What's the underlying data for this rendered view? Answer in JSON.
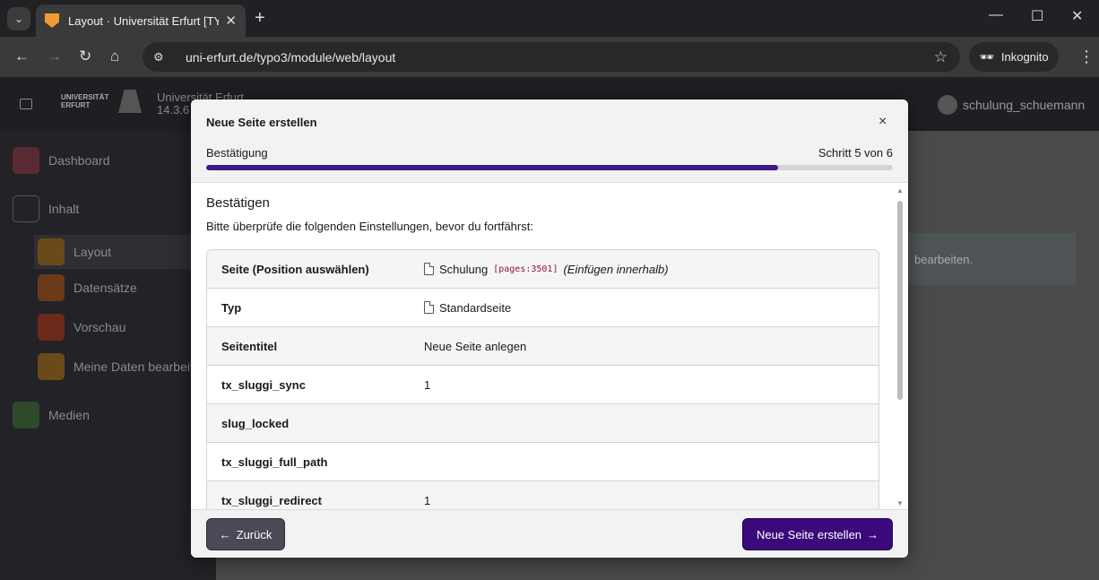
{
  "browser": {
    "tab_title": "Layout · Universität Erfurt [TYPO",
    "url": "uni-erfurt.de/typo3/module/web/layout",
    "incognito_label": "Inkognito"
  },
  "backend": {
    "site_name_line1": "Universität Erfurt",
    "site_name_line2": "14.3.6",
    "logo_line1": "UNIVERSITÄT",
    "logo_line2": "ERFURT",
    "username": "schulung_schuemann",
    "sidebar": {
      "items": [
        {
          "label": "Dashboard"
        },
        {
          "label": "Inhalt"
        },
        {
          "label": "Layout"
        },
        {
          "label": "Datensätze"
        },
        {
          "label": "Vorschau"
        },
        {
          "label": "Meine Daten bearbeit"
        },
        {
          "label": "Medien"
        }
      ]
    },
    "content_snippet": "bearbeiten."
  },
  "modal": {
    "title": "Neue Seite erstellen",
    "close_symbol": "×",
    "step_label": "Bestätigung",
    "step_count": "Schritt 5 von 6",
    "progress_fraction": 0.833,
    "heading": "Bestätigen",
    "intro": "Bitte überprüfe die folgenden Einstellungen, bevor du fortfährst:",
    "rows": [
      {
        "key": "Seite (Position auswählen)",
        "value": "Schulung",
        "code": "[pages:3501]",
        "hint": "(Einfügen innerhalb)"
      },
      {
        "key": "Typ",
        "value": "Standardseite"
      },
      {
        "key": "Seitentitel",
        "value": "Neue Seite anlegen"
      },
      {
        "key": "tx_sluggi_sync",
        "value": "1"
      },
      {
        "key": "slug_locked",
        "value": ""
      },
      {
        "key": "tx_sluggi_full_path",
        "value": ""
      },
      {
        "key": "tx_sluggi_redirect",
        "value": "1"
      }
    ],
    "back_label": "Zurück",
    "next_label": "Neue Seite erstellen"
  },
  "colors": {
    "primary": "#3a0a7a",
    "progress": "#3f1a8a",
    "back_button": "#4a4a56"
  }
}
